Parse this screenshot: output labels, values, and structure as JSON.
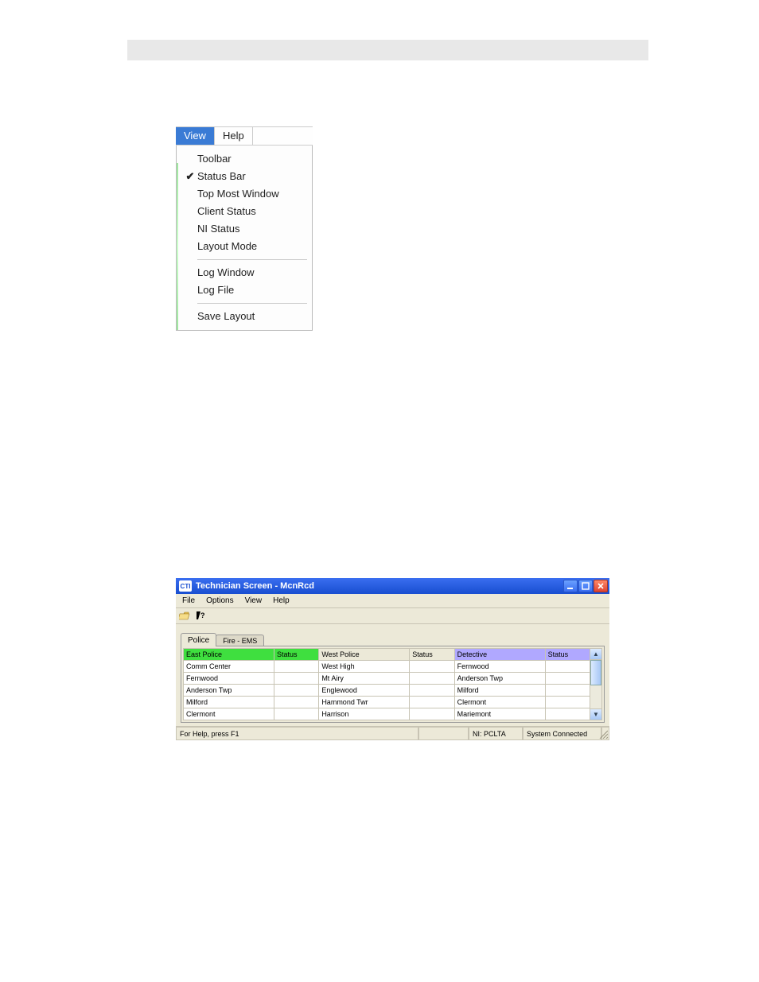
{
  "view_menu": {
    "bar": {
      "view": "View",
      "help": "Help"
    },
    "items_group1": [
      {
        "label": "Toolbar",
        "checked": false
      },
      {
        "label": "Status Bar",
        "checked": true
      },
      {
        "label": "Top Most Window",
        "checked": false
      },
      {
        "label": "Client Status",
        "checked": false
      },
      {
        "label": "NI Status",
        "checked": false
      },
      {
        "label": "Layout Mode",
        "checked": false
      }
    ],
    "items_group2": [
      {
        "label": "Log Window",
        "checked": false
      },
      {
        "label": "Log File",
        "checked": false
      }
    ],
    "items_group3": [
      {
        "label": "Save Layout",
        "checked": false
      }
    ]
  },
  "app_window": {
    "icon_text": "CTI",
    "title": "Technician Screen - McnRcd",
    "menus": [
      "File",
      "Options",
      "View",
      "Help"
    ],
    "tabs": {
      "active": "Police",
      "inactive": "Fire - EMS"
    },
    "columns": [
      "East Police",
      "Status",
      "West Police",
      "Status",
      "Detective",
      "Status"
    ],
    "rows": [
      [
        "Comm Center",
        "",
        "West High",
        "",
        "Fernwood",
        ""
      ],
      [
        "Fernwood",
        "",
        "Mt Airy",
        "",
        "Anderson Twp",
        ""
      ],
      [
        "Anderson Twp",
        "",
        "Englewood",
        "",
        "Milford",
        ""
      ],
      [
        "Milford",
        "",
        "Hammond Twr",
        "",
        "Clermont",
        ""
      ],
      [
        "Clermont",
        "",
        "Harrison",
        "",
        "Mariemont",
        ""
      ]
    ],
    "status": {
      "help": "For Help, press F1",
      "ni": "NI: PCLTA",
      "sys": "System Connected"
    }
  }
}
